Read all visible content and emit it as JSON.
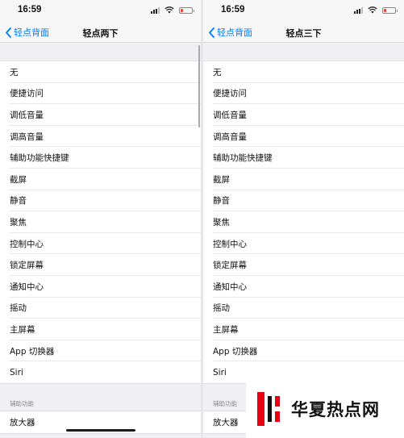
{
  "left_screen": {
    "status": {
      "time": "16:59"
    },
    "nav": {
      "back_label": "轻点背面",
      "title": "轻点两下"
    },
    "items": [
      "无",
      "便捷访问",
      "调低音量",
      "调高音量",
      "辅助功能快捷键",
      "截屏",
      "静音",
      "聚焦",
      "控制中心",
      "锁定屏幕",
      "通知中心",
      "摇动",
      "主屏幕",
      "App 切换器",
      "Siri"
    ],
    "accessibility_section": {
      "header": "辅助功能",
      "items": [
        "放大器"
      ]
    }
  },
  "right_screen": {
    "status": {
      "time": "16:59"
    },
    "nav": {
      "back_label": "轻点背面",
      "title": "轻点三下"
    },
    "items": [
      "无",
      "便捷访问",
      "调低音量",
      "调高音量",
      "辅助功能快捷键",
      "截屏",
      "静音",
      "聚焦",
      "控制中心",
      "锁定屏幕",
      "通知中心",
      "摇动",
      "主屏幕",
      "App 切换器",
      "Siri"
    ],
    "accessibility_section": {
      "header": "辅助功能",
      "items": [
        "放大器"
      ]
    }
  },
  "watermark": {
    "text": "华夏热点网"
  },
  "colors": {
    "accent": "#007aff",
    "battery_low": "#ff3b30",
    "background": "#efeff4",
    "watermark_red": "#e60012"
  }
}
